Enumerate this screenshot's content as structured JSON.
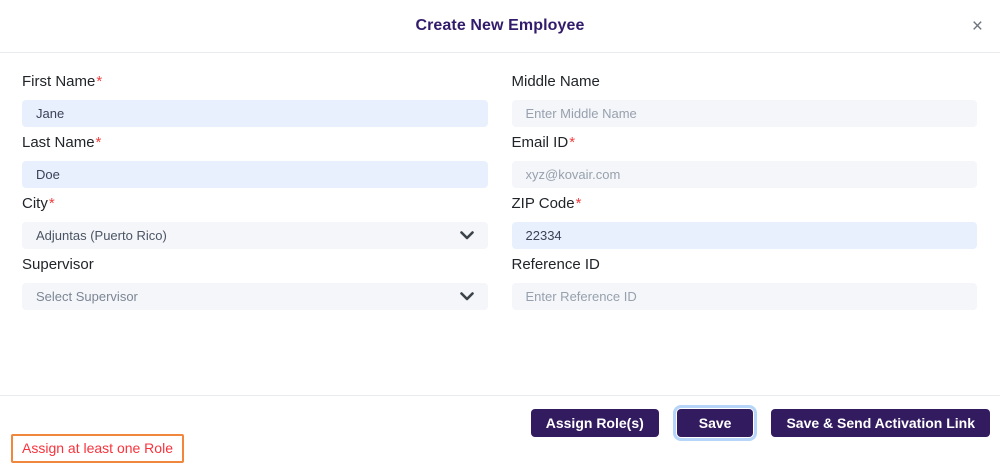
{
  "modal": {
    "title": "Create New Employee",
    "close_label": "×"
  },
  "form": {
    "fields": [
      {
        "label": "First Name",
        "required_mark": "*",
        "value": "Jane"
      },
      {
        "label": "Middle Name",
        "placeholder": "Enter Middle Name"
      },
      {
        "label": "Last Name",
        "required_mark": "*",
        "value": "Doe"
      },
      {
        "label": "Email ID",
        "required_mark": "*",
        "placeholder": "xyz@kovair.com"
      },
      {
        "label": "City",
        "required_mark": "*",
        "value": "Adjuntas (Puerto Rico)"
      },
      {
        "label": "ZIP Code",
        "required_mark": "*",
        "value": "22334"
      },
      {
        "label": "Supervisor",
        "placeholder": "Select Supervisor"
      },
      {
        "label": "Reference ID",
        "placeholder": "Enter Reference ID"
      }
    ]
  },
  "footer": {
    "assign_roles_label": "Assign Role(s)",
    "save_label": "Save",
    "save_send_label": "Save & Send Activation Link"
  },
  "validation": {
    "message": "Assign at least one Role"
  },
  "colors": {
    "accent_purple": "#321b5f",
    "title_purple": "#321b6b",
    "filled_input_bg": "#e8f0fe",
    "empty_input_bg": "#f4f6fa",
    "required_red": "#f03e3e",
    "error_text": "#f8333c",
    "error_border": "#f0873d",
    "focus_ring_blue": "#b6d5f8"
  }
}
